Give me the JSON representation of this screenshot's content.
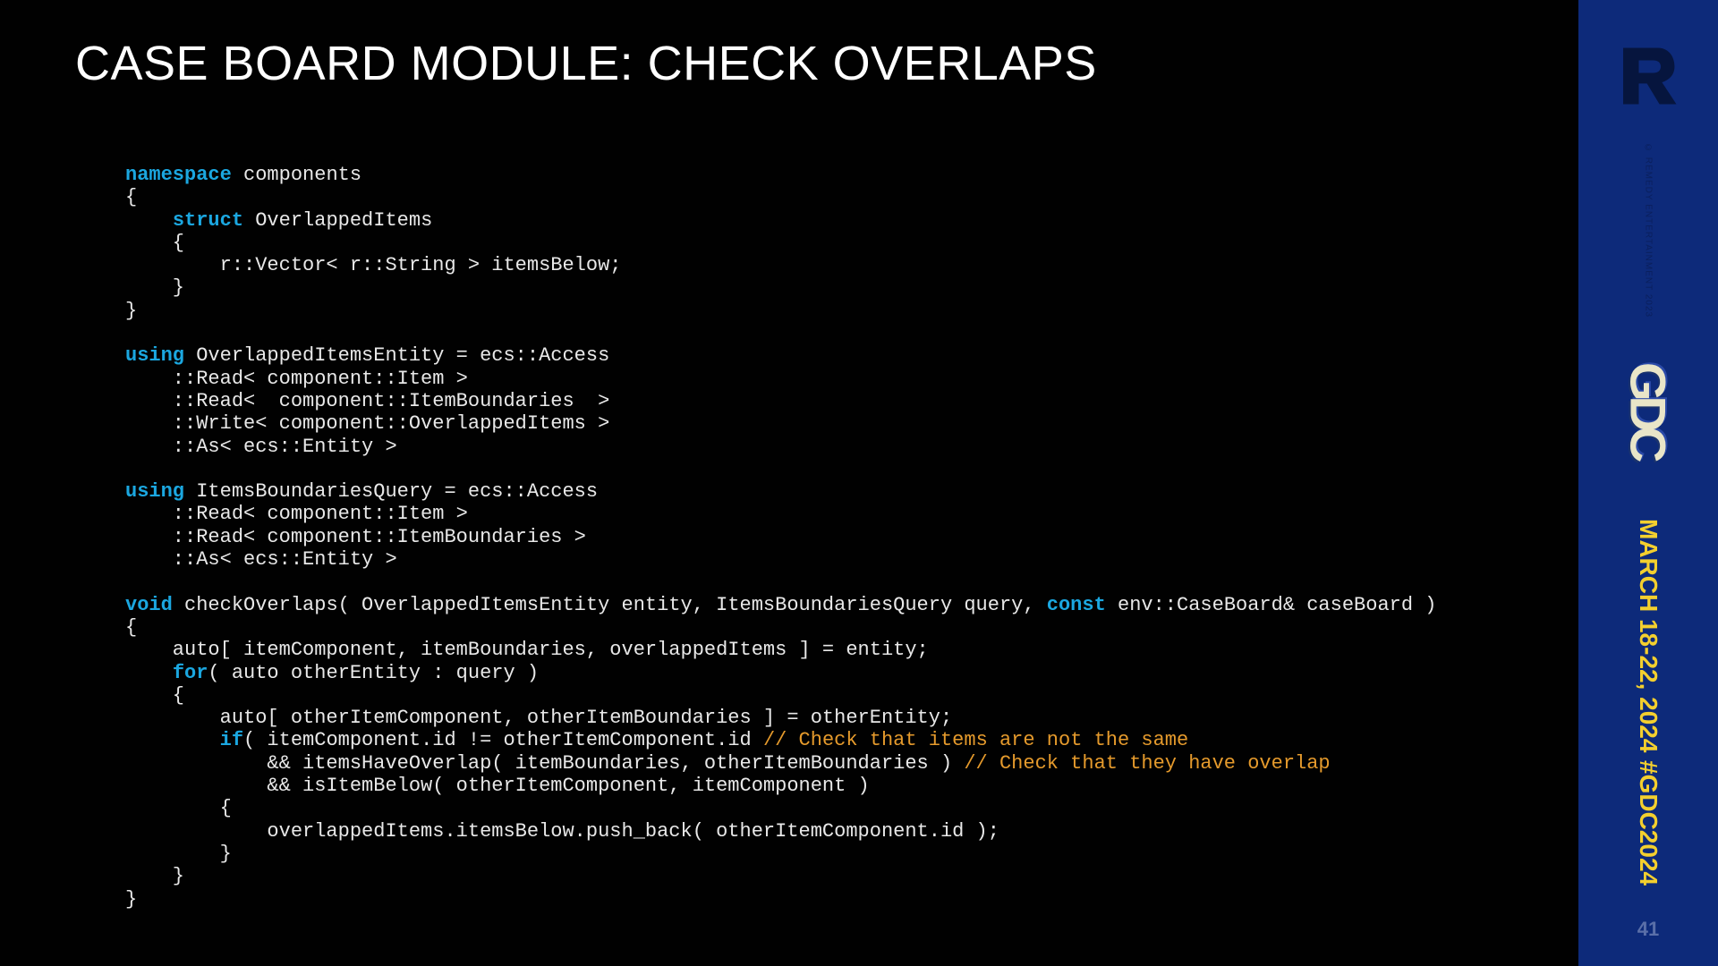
{
  "title": "CASE BOARD MODULE: CHECK OVERLAPS",
  "code": {
    "l01a": "namespace",
    "l01b": " components",
    "l02": "{",
    "l03a": "    ",
    "l03b": "struct",
    "l03c": " OverlappedItems",
    "l04": "    {",
    "l05": "        r::Vector< r::String > itemsBelow;",
    "l06": "    }",
    "l07": "}",
    "l08": "",
    "l09a": "using",
    "l09b": " OverlappedItemsEntity = ecs::Access",
    "l10": "    ::Read< component::Item >",
    "l11": "    ::Read<  component::ItemBoundaries  >",
    "l12": "    ::Write< component::OverlappedItems >",
    "l13": "    ::As< ecs::Entity >",
    "l14": "",
    "l15a": "using",
    "l15b": " ItemsBoundariesQuery = ecs::Access",
    "l16": "    ::Read< component::Item >",
    "l17": "    ::Read< component::ItemBoundaries >",
    "l18": "    ::As< ecs::Entity >",
    "l19": "",
    "l20a": "void",
    "l20b": " checkOverlaps( OverlappedItemsEntity entity, ItemsBoundariesQuery query, ",
    "l20c": "const",
    "l20d": " env::CaseBoard& caseBoard )",
    "l21": "{",
    "l22": "    auto[ itemComponent, itemBoundaries, overlappedItems ] = entity;",
    "l23a": "    ",
    "l23b": "for",
    "l23c": "( auto otherEntity : query )",
    "l24": "    {",
    "l25": "        auto[ otherItemComponent, otherItemBoundaries ] = otherEntity;",
    "l26a": "        ",
    "l26b": "if",
    "l26c": "( itemComponent.id != otherItemComponent.id ",
    "l26d": "// Check that items are not the same",
    "l27a": "            && itemsHaveOverlap( itemBoundaries, otherItemBoundaries ) ",
    "l27b": "// Check that they have overlap",
    "l28": "            && isItemBelow( otherItemComponent, itemComponent )",
    "l29": "        {",
    "l30": "            overlappedItems.itemsBelow.push_back( otherItemComponent.id );",
    "l31": "        }",
    "l32": "    }",
    "l33": "}"
  },
  "sidebar": {
    "copyright": "© REMEDY ENTERTAINMENT 2023",
    "gdc": "GDC",
    "dates": "MARCH 18-22, 2024",
    "hashtag": "#GDC2024",
    "page": "41"
  }
}
